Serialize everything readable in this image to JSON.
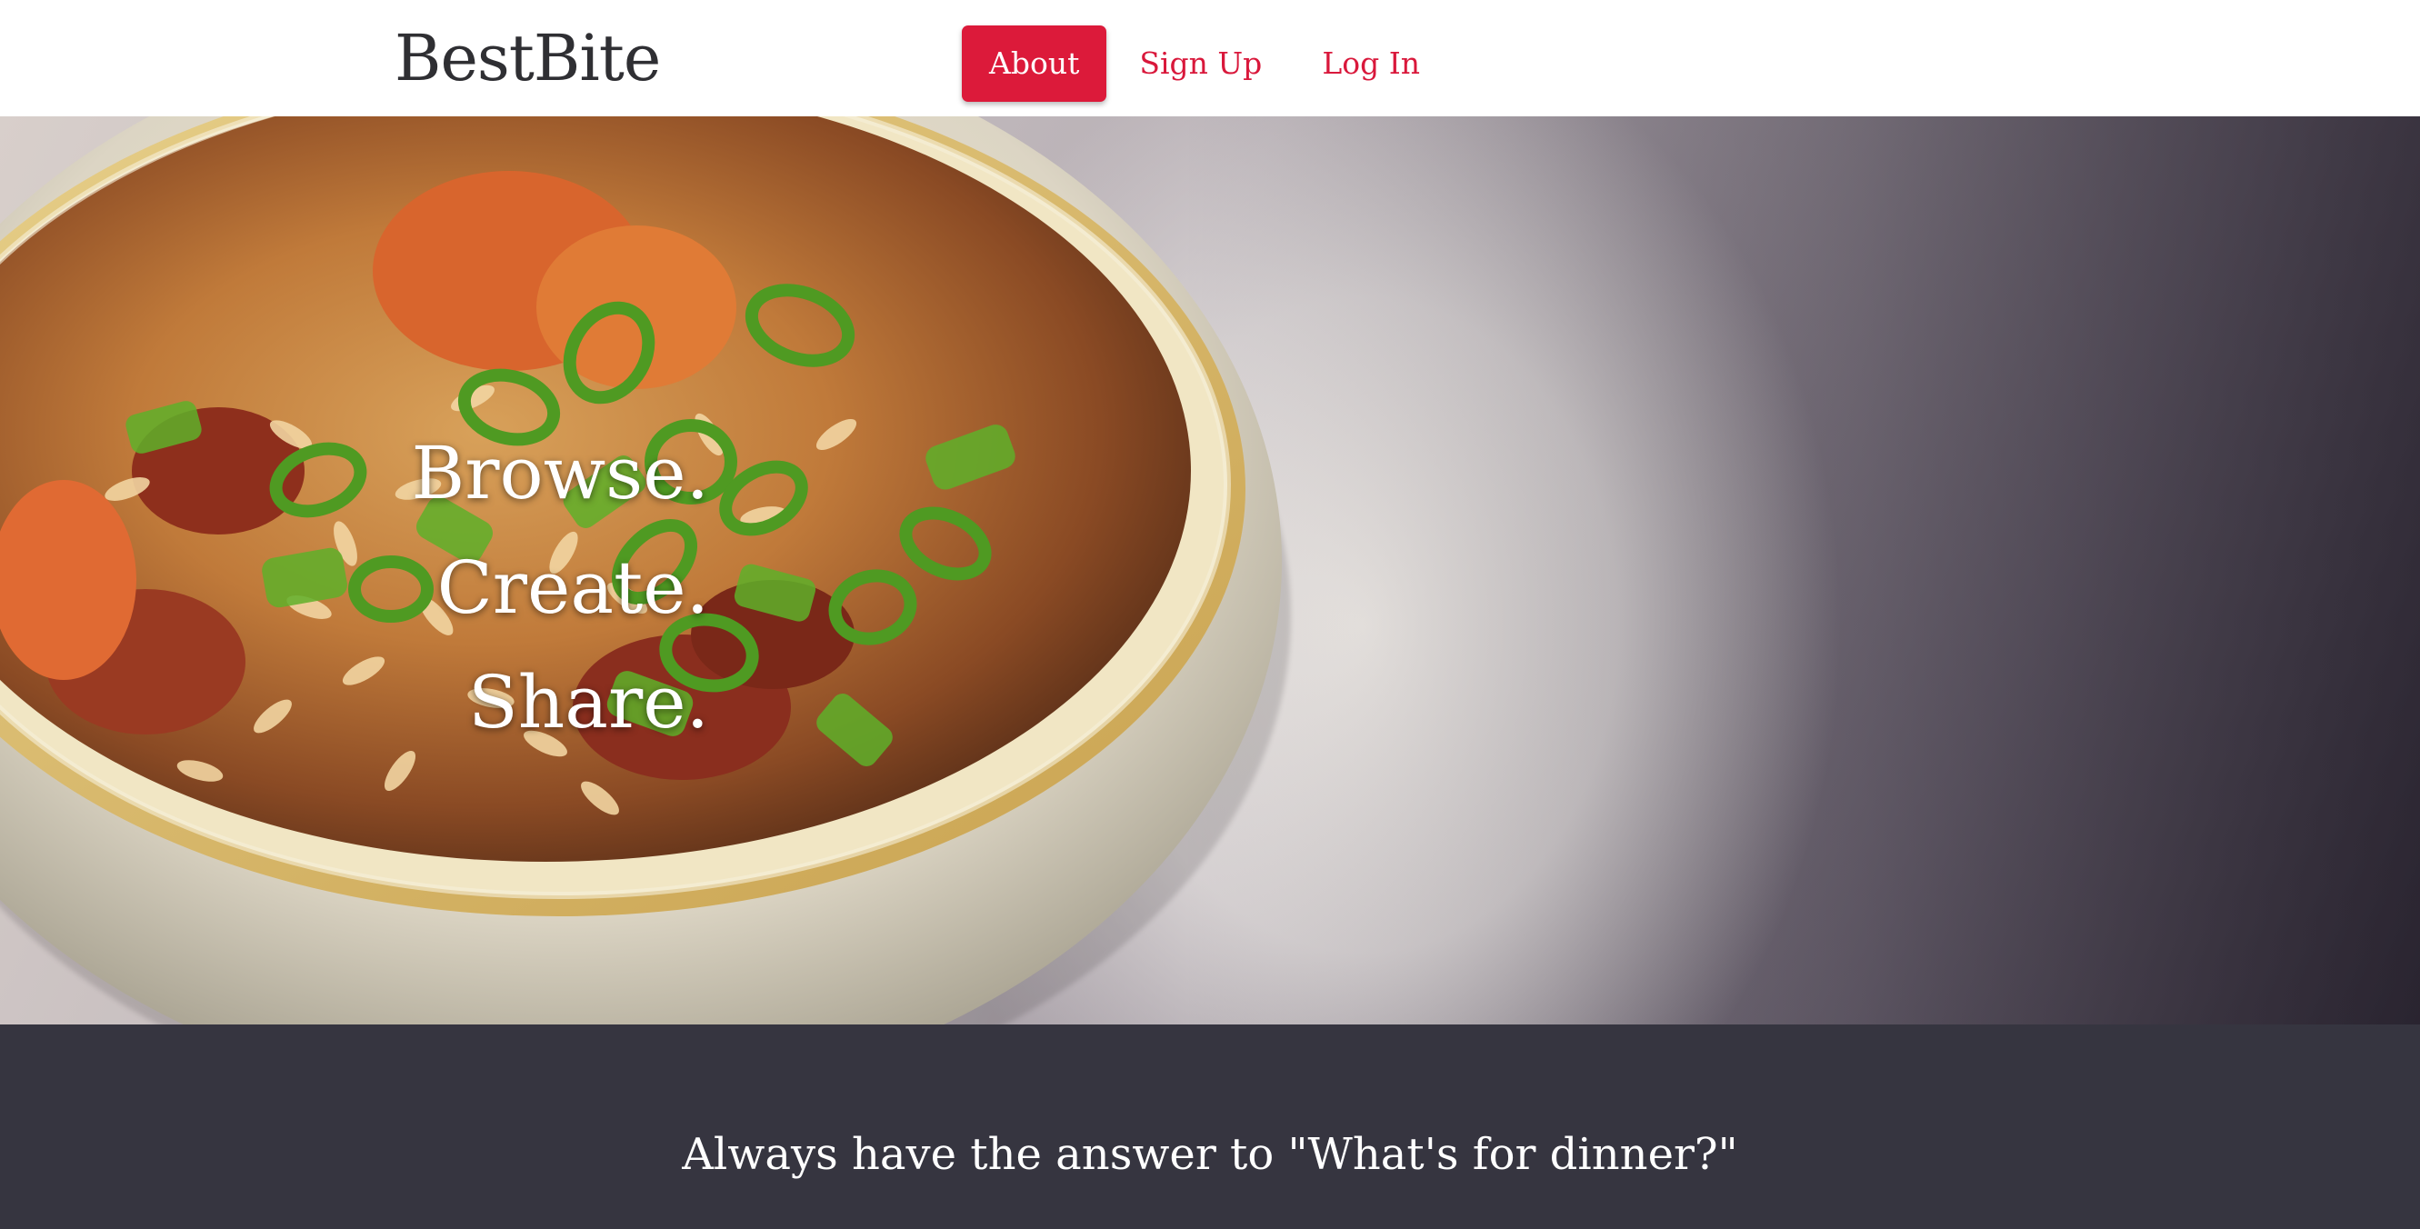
{
  "brand": {
    "name": "BestBite"
  },
  "nav": {
    "items": [
      {
        "label": "About",
        "active": true
      },
      {
        "label": "Sign Up",
        "active": false
      },
      {
        "label": "Log In",
        "active": false
      }
    ]
  },
  "hero": {
    "image": "bowl-of-jambalaya-with-green-onions",
    "lines": [
      "Browse.",
      "Create.",
      "Share."
    ]
  },
  "footer": {
    "tagline": "Always have the answer to \"What's for dinner?\""
  },
  "colors": {
    "accent": "#dc1a3a",
    "link": "#d9183b",
    "band": "#363540",
    "brand_text": "#2f2f33"
  }
}
